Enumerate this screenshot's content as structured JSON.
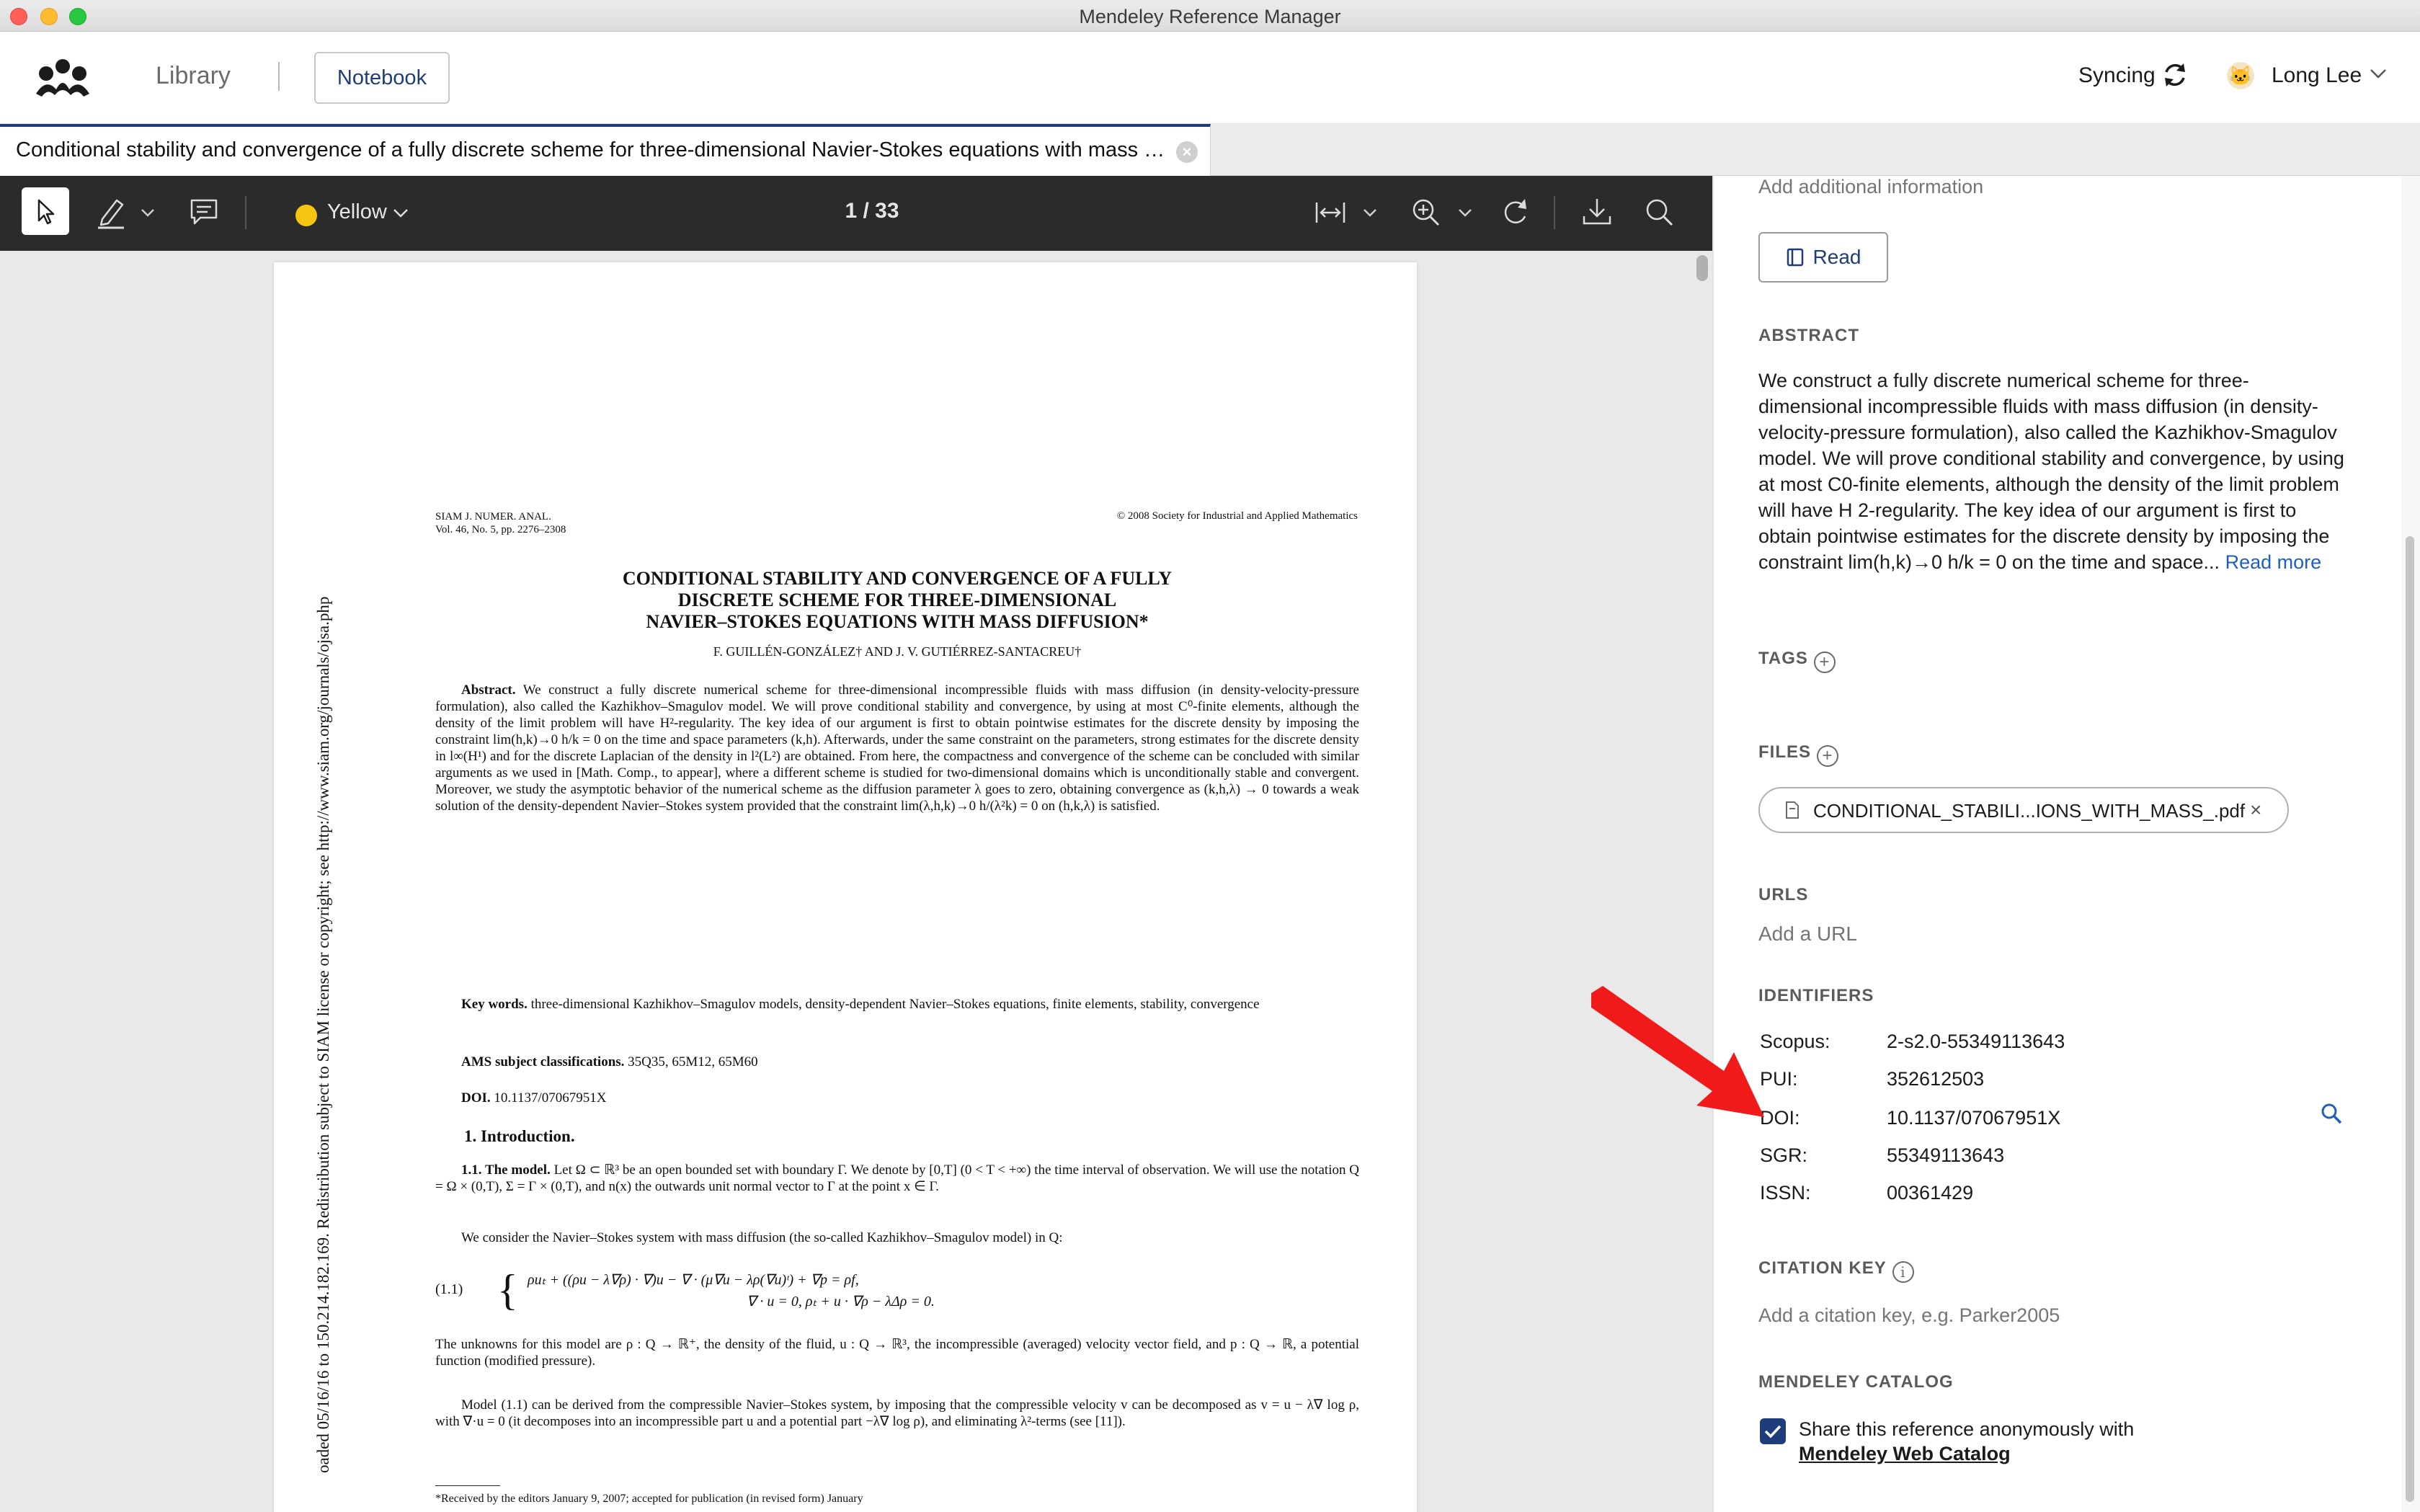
{
  "window": {
    "title": "Mendeley Reference Manager"
  },
  "header": {
    "library_label": "Library",
    "notebook_label": "Notebook",
    "sync_label": "Syncing",
    "user_name": "Long Lee"
  },
  "tab": {
    "title": "Conditional stability and convergence of a fully discrete scheme for three-dimensional Navier-Stokes equations with mass di..."
  },
  "pdf_toolbar": {
    "highlight_color_name": "Yellow",
    "highlight_color": "#f6c514",
    "page_counter": "1 / 33"
  },
  "pdf_page": {
    "side_watermark": "oaded 05/16/16 to 150.214.182.169. Redistribution subject to SIAM license or copyright; see http://www.siam.org/journals/ojsa.php",
    "journal_line1": "SIAM J. NUMER. ANAL.",
    "journal_line2": "Vol. 46, No. 5, pp. 2276–2308",
    "copyright": "© 2008 Society for Industrial and Applied Mathematics",
    "title_line1": "CONDITIONAL STABILITY AND CONVERGENCE OF A FULLY",
    "title_line2": "DISCRETE SCHEME FOR THREE-DIMENSIONAL",
    "title_line3": "NAVIER–STOKES EQUATIONS WITH MASS DIFFUSION*",
    "authors": "F. GUILLÉN-GONZÁLEZ† AND J. V. GUTIÉRREZ-SANTACREU†",
    "abstract_label": "Abstract.",
    "abstract_text": "We construct a fully discrete numerical scheme for three-dimensional incompressible fluids with mass diffusion (in density-velocity-pressure formulation), also called the Kazhikhov–Smagulov model. We will prove conditional stability and convergence, by using at most C⁰-finite elements, although the density of the limit problem will have H²-regularity. The key idea of our argument is first to obtain pointwise estimates for the discrete density by imposing the constraint lim(h,k)→0 h/k = 0 on the time and space parameters (k,h). Afterwards, under the same constraint on the parameters, strong estimates for the discrete density in l∞(H¹) and for the discrete Laplacian of the density in l²(L²) are obtained. From here, the compactness and convergence of the scheme can be concluded with similar arguments as we used in [Math. Comp., to appear], where a different scheme is studied for two-dimensional domains which is unconditionally stable and convergent. Moreover, we study the asymptotic behavior of the numerical scheme as the diffusion parameter λ goes to zero, obtaining convergence as (k,h,λ) → 0 towards a weak solution of the density-dependent Navier–Stokes system provided that the constraint lim(λ,h,k)→0 h/(λ²k) = 0 on (h,k,λ) is satisfied.",
    "keywords_label": "Key words.",
    "keywords_text": "three-dimensional Kazhikhov–Smagulov models, density-dependent Navier–Stokes equations, finite elements, stability, convergence",
    "ams_label": "AMS subject classifications.",
    "ams_text": "35Q35, 65M12, 65M60",
    "doi_label": "DOI.",
    "doi_text": "10.1137/07067951X",
    "section1": "1. Introduction.",
    "subsection_label": "1.1. The model.",
    "model_text": "Let Ω ⊂ ℝ³ be an open bounded set with boundary Γ. We denote by [0,T] (0 < T < +∞) the time interval of observation. We will use the notation Q = Ω × (0,T), Σ = Γ × (0,T), and n(x) the outwards unit normal vector to Γ at the point x ∈ Γ.",
    "consider_text": "We consider the Navier–Stokes system with mass diffusion (the so-called Kazhikhov–Smagulov model) in Q:",
    "eq_number": "(1.1)",
    "eq_line1": "ρuₜ + ((ρu − λ∇ρ) · ∇)u − ∇ · (μ∇u − λρ(∇u)ᵗ) + ∇p  =  ρf,",
    "eq_line2": "∇ · u = 0,        ρₜ + u · ∇ρ − λΔρ  =  0.",
    "unknowns_text": "The unknowns for this model are ρ : Q → ℝ⁺, the density of the fluid, u : Q → ℝ³, the incompressible (averaged) velocity vector field, and p : Q → ℝ, a potential function (modified pressure).",
    "derived_text": "Model (1.1) can be derived from the compressible Navier–Stokes system, by imposing that the compressible velocity v can be decomposed as v = u − λ∇ log ρ, with ∇·u = 0 (it decomposes into an incompressible part u and a potential part −λ∇ log ρ), and eliminating λ²-terms (see [11]).",
    "footnote": "*Received by the editors January 9, 2007; accepted for publication (in revised form) January"
  },
  "details": {
    "add_info": "Add additional information",
    "read_button": "Read",
    "abstract_heading": "ABSTRACT",
    "abstract_text": "We construct a fully discrete numerical scheme for three-dimensional incompressible fluids with mass diffusion (in density-velocity-pressure formulation), also called the Kazhikhov-Smagulov model. We will prove conditional stability and convergence, by using at most C0-finite elements, although the density of the limit problem will have H 2-regularity. The key idea of our argument is first to obtain pointwise estimates for the discrete density by imposing the constraint lim(h,k)→0 h/k = 0 on the time and space...",
    "read_more": "Read more",
    "tags_heading": "TAGS",
    "files_heading": "FILES",
    "file_name": "CONDITIONAL_STABILI...IONS_WITH_MASS_.pdf",
    "urls_heading": "URLS",
    "add_url": "Add a URL",
    "identifiers_heading": "IDENTIFIERS",
    "identifiers": [
      {
        "label": "Scopus:",
        "value": "2-s2.0-55349113643"
      },
      {
        "label": "PUI:",
        "value": "352612503"
      },
      {
        "label": "DOI:",
        "value": "10.1137/07067951X"
      },
      {
        "label": "SGR:",
        "value": "55349113643"
      },
      {
        "label": "ISSN:",
        "value": "00361429"
      }
    ],
    "citation_key_heading": "CITATION KEY",
    "citation_key_placeholder": "Add a citation key, e.g. Parker2005",
    "catalog_heading": "MENDELEY CATALOG",
    "share_text": "Share this reference anonymously with",
    "share_link": "Mendeley Web Catalog",
    "share_checked": true
  },
  "colors": {
    "brand": "#1f3d7a",
    "link": "#1f5fbf",
    "annotation_arrow": "#f11a1a",
    "toolbar_bg": "#2b2b2b"
  }
}
